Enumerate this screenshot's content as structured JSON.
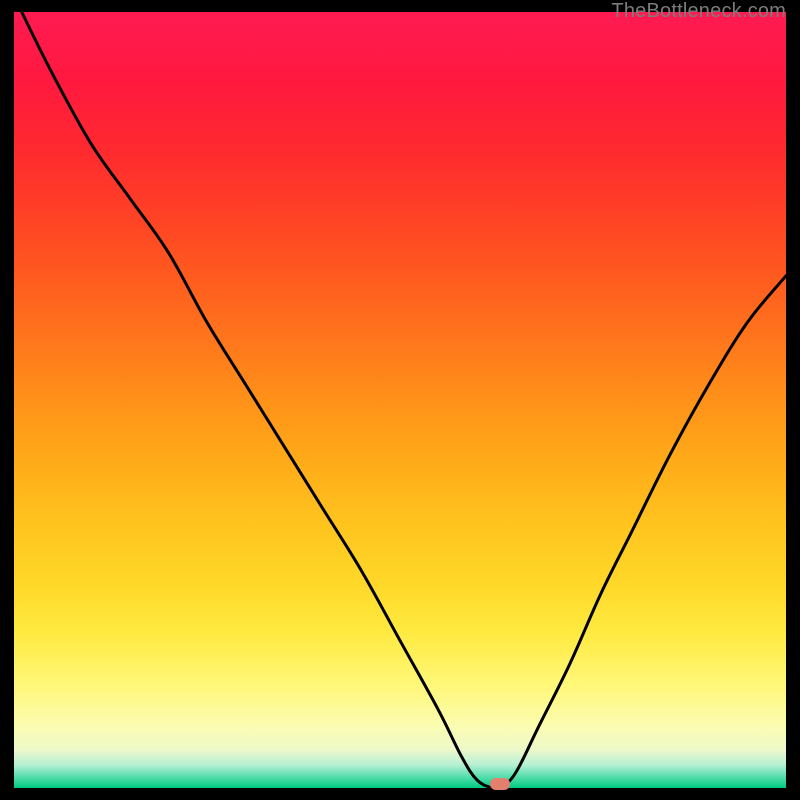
{
  "watermark": "TheBottleneck.com",
  "chart_data": {
    "type": "line",
    "title": "",
    "xlabel": "",
    "ylabel": "",
    "xlim": [
      0,
      100
    ],
    "ylim": [
      0,
      100
    ],
    "grid": false,
    "legend": false,
    "series": [
      {
        "name": "curve-left",
        "x": [
          1,
          5,
          10,
          15,
          20,
          25,
          30,
          35,
          40,
          45,
          50,
          55,
          58,
          60,
          62,
          63
        ],
        "y": [
          100,
          92,
          83,
          76,
          69,
          60,
          52,
          44,
          36,
          28,
          19,
          10,
          4,
          1,
          0,
          0
        ]
      },
      {
        "name": "curve-right",
        "x": [
          63,
          65,
          68,
          72,
          76,
          80,
          85,
          90,
          95,
          100
        ],
        "y": [
          0,
          2,
          8,
          16,
          25,
          33,
          43,
          52,
          60,
          66
        ]
      }
    ],
    "marker": {
      "x": 63,
      "y": 0,
      "color": "#e37f6e"
    },
    "gradient_bands": [
      {
        "pos": 0.0,
        "color": "#ff1a52",
        "label": "red-pink"
      },
      {
        "pos": 0.5,
        "color": "#ff9119",
        "label": "orange"
      },
      {
        "pos": 0.8,
        "color": "#ffea41",
        "label": "yellow"
      },
      {
        "pos": 1.0,
        "color": "#00c97f",
        "label": "green"
      }
    ]
  }
}
